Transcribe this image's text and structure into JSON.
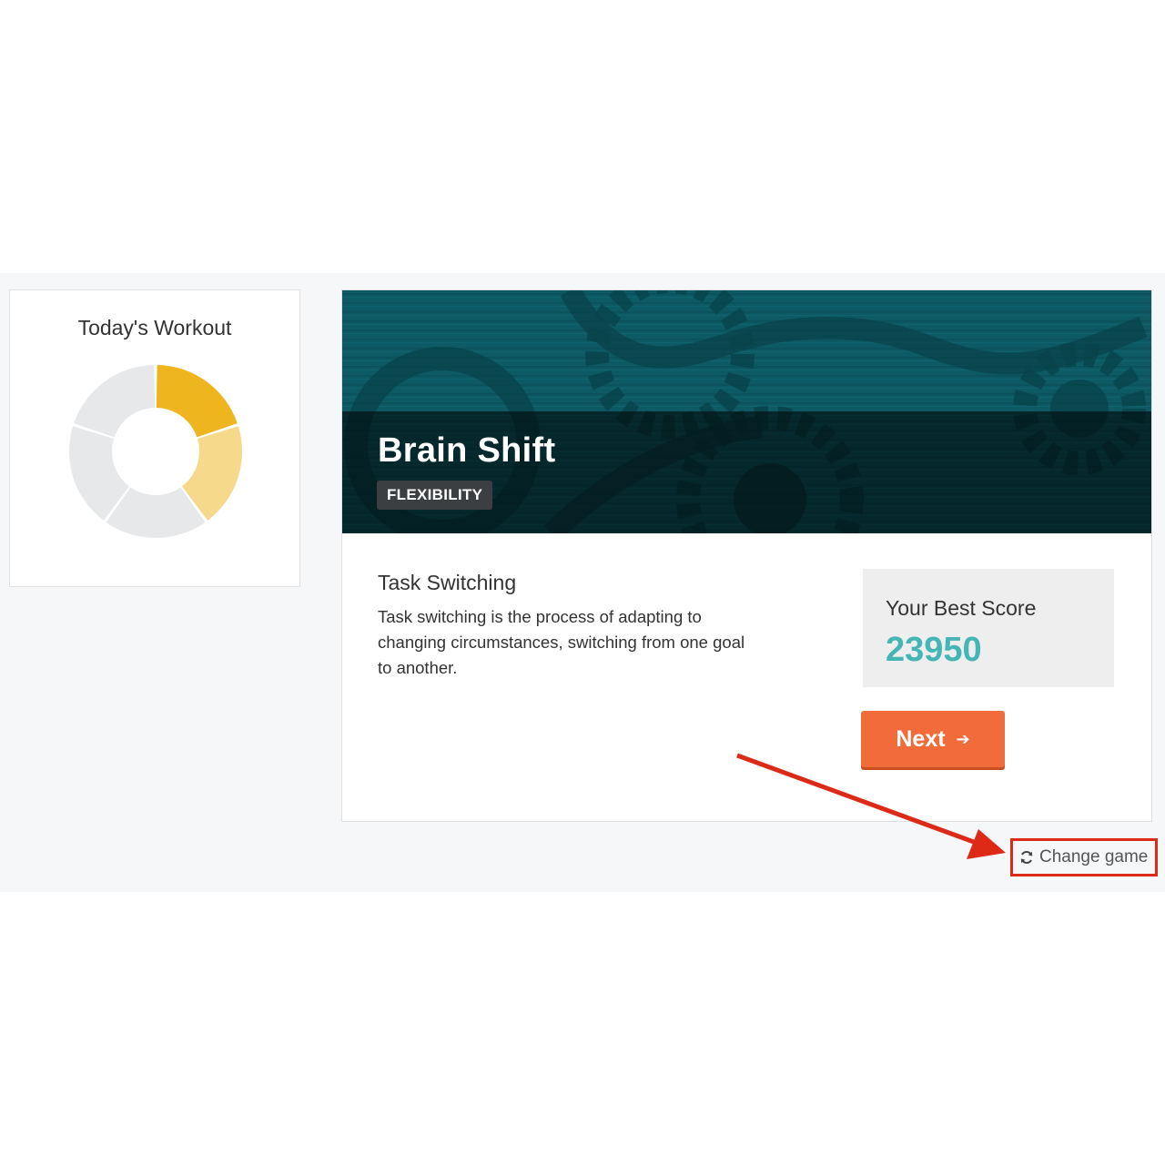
{
  "workout": {
    "title": "Today's Workout",
    "segments": [
      {
        "value": 1,
        "color": "#efb51f",
        "state": "done"
      },
      {
        "value": 1,
        "color": "#f7d98b",
        "state": "current"
      },
      {
        "value": 1,
        "color": "#e7e8e9",
        "state": "pending"
      },
      {
        "value": 1,
        "color": "#e7e8e9",
        "state": "pending"
      },
      {
        "value": 1,
        "color": "#e7e8e9",
        "state": "pending"
      }
    ]
  },
  "game": {
    "title": "Brain Shift",
    "category": "FLEXIBILITY",
    "skill_title": "Task Switching",
    "skill_description": "Task switching is the process of adapting to changing circumstances, switching from one goal to another.",
    "banner_color": "#0c5862"
  },
  "score": {
    "label": "Your Best Score",
    "value": "23950",
    "value_color": "#45b6b5"
  },
  "actions": {
    "next_label": "Next",
    "next_color": "#f26b3a",
    "change_game_label": "Change game",
    "change_game_icon": "refresh-icon"
  },
  "annotation": {
    "highlight_color": "#dc2a16",
    "points_to": "change-game-link"
  }
}
